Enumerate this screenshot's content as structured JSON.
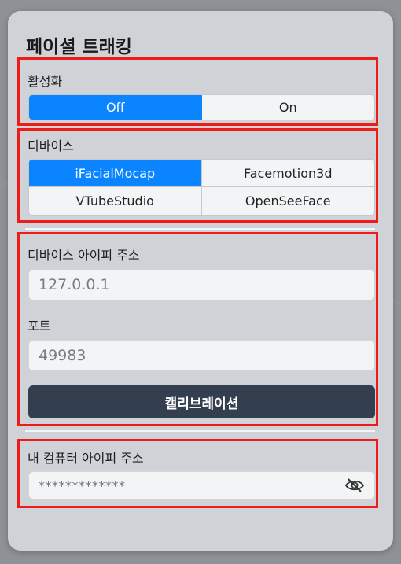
{
  "panel": {
    "title": "페이셜 트래킹"
  },
  "activation": {
    "label": "활성화",
    "options": [
      "Off",
      "On"
    ],
    "selected": "Off"
  },
  "device": {
    "label": "디바이스",
    "options": [
      "iFacialMocap",
      "Facemotion3d",
      "VTubeStudio",
      "OpenSeeFace"
    ],
    "selected": "iFacialMocap"
  },
  "connection": {
    "ip_label": "디바이스 아이피 주소",
    "ip_placeholder": "127.0.0.1",
    "port_label": "포트",
    "port_placeholder": "49983",
    "calibrate_label": "캘리브레이션"
  },
  "my_ip": {
    "label": "내 컴퓨터 아이피 주소",
    "masked_value": "*************",
    "toggle_icon": "eye-slash-icon"
  },
  "colors": {
    "accent": "#0a84ff",
    "button_dark": "#333f4e",
    "highlight_border": "#ee1b1b",
    "panel": "#cfd2d6"
  }
}
